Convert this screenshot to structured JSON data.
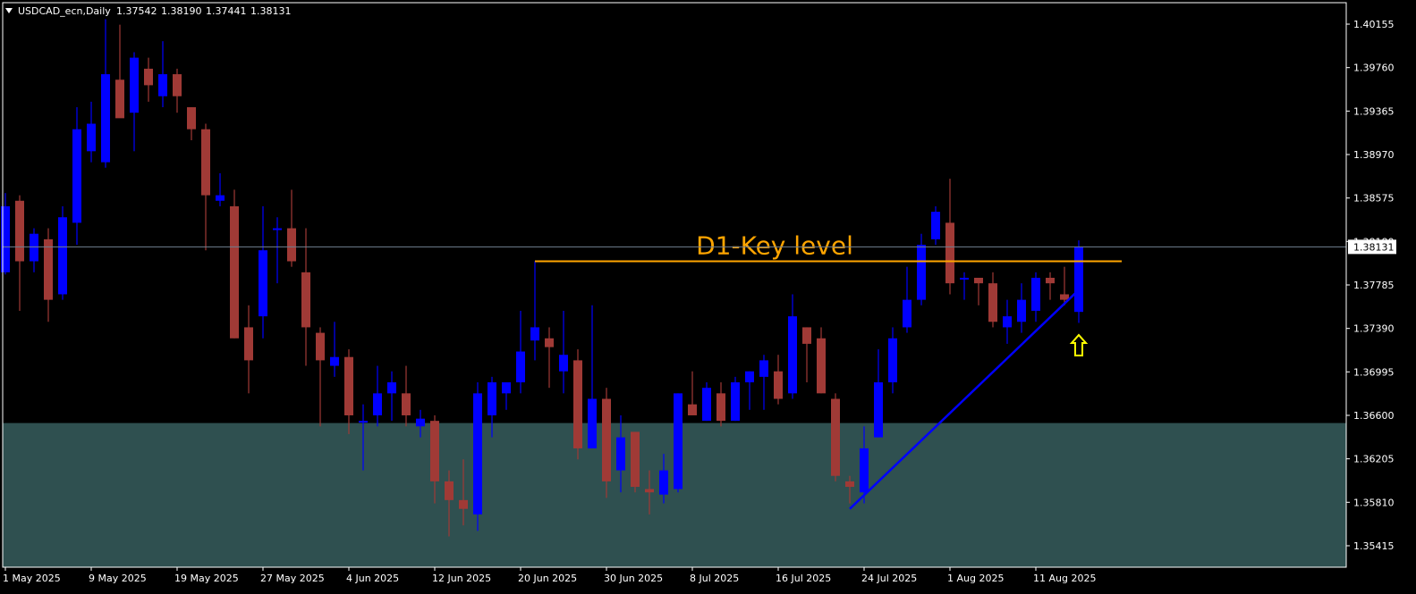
{
  "window": {
    "title": "USDCAD_ecn,Daily",
    "ohlc": [
      "1.37542",
      "1.38190",
      "1.37441",
      "1.38131"
    ]
  },
  "colors": {
    "background": "#000000",
    "axis": "#ffffff",
    "bull": "#0000ff",
    "bear": "#a03a36",
    "zone": "#2f5050",
    "key_level": "#ffa500",
    "trendline": "#0000ff",
    "arrow": "#ffff00",
    "price_line": "#708090"
  },
  "chart_data": {
    "type": "candlestick",
    "symbol": "USDCAD_ecn",
    "timeframe": "Daily",
    "ylim": [
      1.3522,
      1.4035
    ],
    "y_ticks": [
      "1.40155",
      "1.39760",
      "1.39365",
      "1.38970",
      "1.38575",
      "1.38180",
      "1.37785",
      "1.37390",
      "1.36995",
      "1.36600",
      "1.36205",
      "1.35810",
      "1.35415"
    ],
    "current_price": "1.38131",
    "x_labels": [
      {
        "label": "1 May 2025",
        "index": 0
      },
      {
        "label": "9 May 2025",
        "index": 6
      },
      {
        "label": "19 May 2025",
        "index": 12
      },
      {
        "label": "27 May 2025",
        "index": 18
      },
      {
        "label": "4 Jun 2025",
        "index": 24
      },
      {
        "label": "12 Jun 2025",
        "index": 30
      },
      {
        "label": "20 Jun 2025",
        "index": 36
      },
      {
        "label": "30 Jun 2025",
        "index": 42
      },
      {
        "label": "8 Jul 2025",
        "index": 48
      },
      {
        "label": "16 Jul 2025",
        "index": 54
      },
      {
        "label": "24 Jul 2025",
        "index": 60
      },
      {
        "label": "1 Aug 2025",
        "index": 66
      },
      {
        "label": "11 Aug 2025",
        "index": 72
      }
    ],
    "candles": [
      [
        1.379,
        1.3862,
        1.3788,
        1.385
      ],
      [
        1.3855,
        1.386,
        1.3755,
        1.38
      ],
      [
        1.38,
        1.383,
        1.379,
        1.3825
      ],
      [
        1.382,
        1.383,
        1.3745,
        1.3765
      ],
      [
        1.377,
        1.385,
        1.3765,
        1.384
      ],
      [
        1.3835,
        1.394,
        1.3815,
        1.392
      ],
      [
        1.39,
        1.3945,
        1.389,
        1.3925
      ],
      [
        1.389,
        1.402,
        1.3885,
        1.397
      ],
      [
        1.3965,
        1.4015,
        1.394,
        1.393
      ],
      [
        1.3935,
        1.399,
        1.39,
        1.3985
      ],
      [
        1.3975,
        1.3985,
        1.3945,
        1.396
      ],
      [
        1.395,
        1.4,
        1.394,
        1.397
      ],
      [
        1.397,
        1.3975,
        1.3935,
        1.395
      ],
      [
        1.394,
        1.394,
        1.391,
        1.392
      ],
      [
        1.392,
        1.3925,
        1.381,
        1.386
      ],
      [
        1.3855,
        1.388,
        1.385,
        1.386
      ],
      [
        1.385,
        1.3865,
        1.373,
        1.373
      ],
      [
        1.374,
        1.376,
        1.368,
        1.371
      ],
      [
        1.375,
        1.385,
        1.373,
        1.381
      ],
      [
        1.383,
        1.384,
        1.378,
        1.383
      ],
      [
        1.383,
        1.3865,
        1.3795,
        1.38
      ],
      [
        1.379,
        1.383,
        1.3705,
        1.374
      ],
      [
        1.3735,
        1.374,
        1.365,
        1.371
      ],
      [
        1.3705,
        1.3745,
        1.3695,
        1.3713
      ],
      [
        1.3713,
        1.372,
        1.3643,
        1.366
      ],
      [
        1.3655,
        1.367,
        1.361,
        1.3655
      ],
      [
        1.366,
        1.3705,
        1.365,
        1.368
      ],
      [
        1.368,
        1.37,
        1.3655,
        1.369
      ],
      [
        1.368,
        1.3705,
        1.365,
        1.366
      ],
      [
        1.365,
        1.3665,
        1.364,
        1.3657
      ],
      [
        1.3655,
        1.366,
        1.358,
        1.36
      ],
      [
        1.36,
        1.361,
        1.355,
        1.3583
      ],
      [
        1.3583,
        1.362,
        1.356,
        1.3575
      ],
      [
        1.357,
        1.369,
        1.3555,
        1.368
      ],
      [
        1.366,
        1.3695,
        1.364,
        1.369
      ],
      [
        1.368,
        1.369,
        1.3665,
        1.369
      ],
      [
        1.369,
        1.3755,
        1.368,
        1.3718
      ],
      [
        1.3728,
        1.38,
        1.371,
        1.374
      ],
      [
        1.373,
        1.374,
        1.3685,
        1.3722
      ],
      [
        1.37,
        1.3755,
        1.368,
        1.3715
      ],
      [
        1.371,
        1.372,
        1.362,
        1.363
      ],
      [
        1.363,
        1.376,
        1.363,
        1.3675
      ],
      [
        1.3675,
        1.3685,
        1.3585,
        1.36
      ],
      [
        1.361,
        1.366,
        1.359,
        1.364
      ],
      [
        1.3645,
        1.3645,
        1.359,
        1.3595
      ],
      [
        1.3593,
        1.361,
        1.357,
        1.359
      ],
      [
        1.3588,
        1.3625,
        1.358,
        1.361
      ],
      [
        1.3593,
        1.368,
        1.359,
        1.368
      ],
      [
        1.367,
        1.37,
        1.366,
        1.366
      ],
      [
        1.3655,
        1.369,
        1.3655,
        1.3685
      ],
      [
        1.368,
        1.369,
        1.365,
        1.3655
      ],
      [
        1.3655,
        1.3695,
        1.3655,
        1.369
      ],
      [
        1.369,
        1.37,
        1.3665,
        1.37
      ],
      [
        1.3695,
        1.3715,
        1.3665,
        1.371
      ],
      [
        1.37,
        1.3715,
        1.367,
        1.3675
      ],
      [
        1.368,
        1.377,
        1.3675,
        1.375
      ],
      [
        1.374,
        1.374,
        1.369,
        1.3725
      ],
      [
        1.373,
        1.374,
        1.368,
        1.368
      ],
      [
        1.3675,
        1.368,
        1.36,
        1.3605
      ],
      [
        1.36,
        1.3605,
        1.358,
        1.3595
      ],
      [
        1.359,
        1.365,
        1.358,
        1.363
      ],
      [
        1.364,
        1.372,
        1.364,
        1.369
      ],
      [
        1.369,
        1.374,
        1.368,
        1.373
      ],
      [
        1.374,
        1.3795,
        1.3735,
        1.3765
      ],
      [
        1.3765,
        1.3825,
        1.376,
        1.3815
      ],
      [
        1.382,
        1.385,
        1.3815,
        1.3845
      ],
      [
        1.3835,
        1.3875,
        1.377,
        1.378
      ],
      [
        1.3785,
        1.379,
        1.3765,
        1.3785
      ],
      [
        1.3785,
        1.3785,
        1.376,
        1.378
      ],
      [
        1.378,
        1.379,
        1.374,
        1.3745
      ],
      [
        1.374,
        1.3765,
        1.3725,
        1.375
      ],
      [
        1.3745,
        1.378,
        1.3735,
        1.3765
      ],
      [
        1.3755,
        1.379,
        1.3745,
        1.3785
      ],
      [
        1.3785,
        1.379,
        1.3765,
        1.378
      ],
      [
        1.377,
        1.3795,
        1.376,
        1.3765
      ],
      [
        1.3754,
        1.3819,
        1.3744,
        1.3813
      ]
    ],
    "support_zone": [
      1.3522,
      1.3653
    ],
    "key_level": {
      "label": "D1-Key level",
      "price": 1.38,
      "from_index": 37,
      "to_index": 78
    },
    "trendline": {
      "from": {
        "index": 59,
        "price": 1.3575
      },
      "to": {
        "index": 75,
        "price": 1.3774
      }
    },
    "arrow_marker": {
      "index": 75,
      "price": 1.3733,
      "direction": "up"
    }
  }
}
